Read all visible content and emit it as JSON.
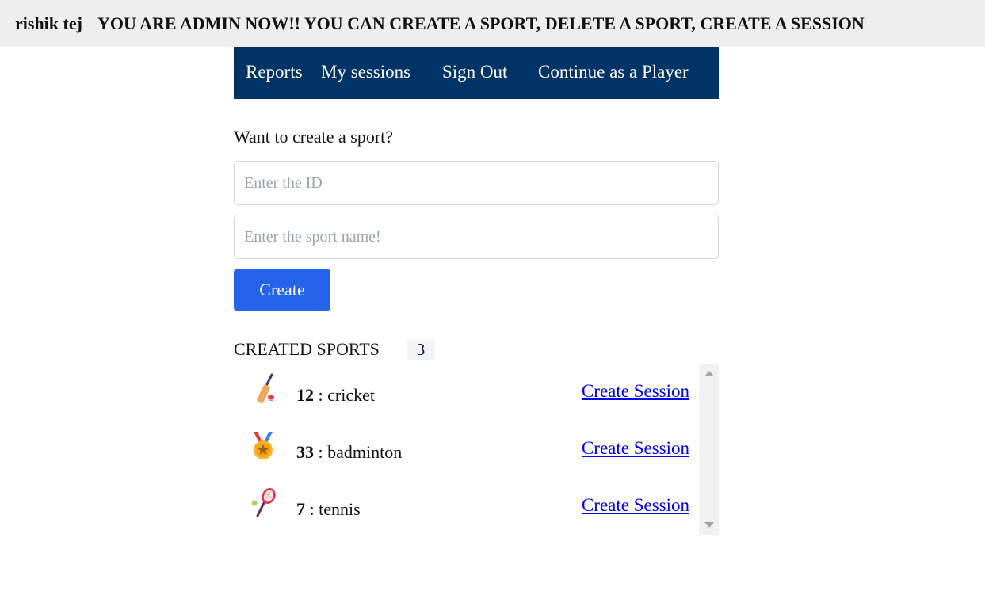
{
  "header": {
    "user_name": "rishik tej",
    "admin_message": "YOU ARE ADMIN NOW!! YOU CAN CREATE A SPORT, DELETE A SPORT, CREATE A SESSION"
  },
  "nav": {
    "reports": "Reports",
    "my_sessions": "My sessions",
    "sign_out": "Sign Out",
    "continue_player": "Continue as a Player"
  },
  "form": {
    "prompt": "Want to create a sport?",
    "id_placeholder": "Enter the ID",
    "name_placeholder": "Enter the sport name!",
    "create_label": "Create"
  },
  "sports_section": {
    "title": "CREATED SPORTS",
    "count": "3",
    "items": [
      {
        "icon": "cricket-bat-icon",
        "id": "12",
        "separator": " : ",
        "name": "cricket",
        "action": "Create Session"
      },
      {
        "icon": "medal-icon",
        "id": "33",
        "separator": " : ",
        "name": "badminton",
        "action": "Create Session"
      },
      {
        "icon": "tennis-racket-icon",
        "id": "7",
        "separator": " : ",
        "name": "tennis",
        "action": "Create Session"
      }
    ]
  },
  "colors": {
    "nav_bg": "#003366",
    "topbar_bg": "#eeeeee",
    "button_bg": "#2563eb",
    "link": "#0000ee"
  }
}
